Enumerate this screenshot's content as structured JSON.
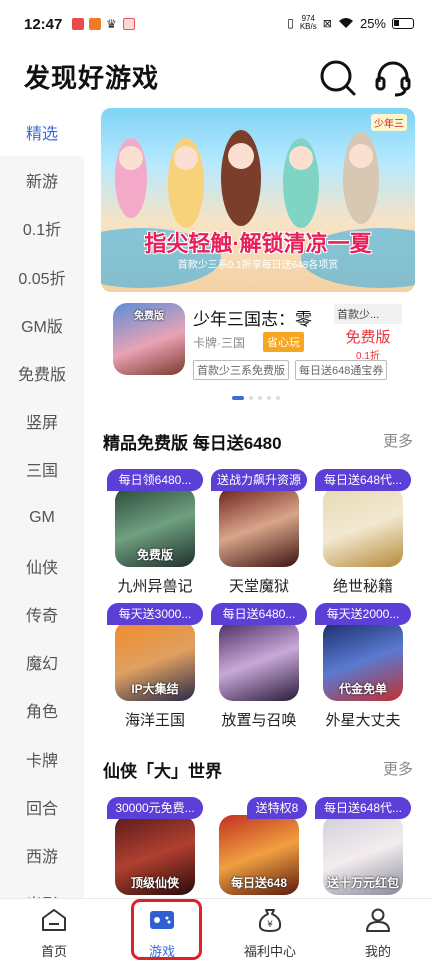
{
  "status_bar": {
    "time": "12:47",
    "net_speed_value": "974",
    "net_speed_unit": "KB/s",
    "battery": "25%"
  },
  "header": {
    "title": "发现好游戏",
    "icons": [
      "search-icon",
      "headset-icon"
    ]
  },
  "sidebar": {
    "items": [
      "精选",
      "新游",
      "0.1折",
      "0.05折",
      "GM版",
      "免费版",
      "竖屏",
      "三国",
      "GM",
      "仙侠",
      "传奇",
      "魔幻",
      "角色",
      "卡牌",
      "回合",
      "西游",
      "光影"
    ],
    "active_index": 0
  },
  "banner": {
    "logo_text": "少年三",
    "headline": "指尖轻触·解锁清凉一夏",
    "subline": "首款少三系0.1折享每日送648各项赏"
  },
  "featured": {
    "icon_label": "免费版",
    "title": "少年三国志：零",
    "subtitle": "卡牌·三国",
    "chip": "省心玩",
    "tags": [
      "首款少三系免费版",
      "每日送648通宝券"
    ],
    "promo_top": "首款少...",
    "promo_main": "免费版",
    "promo_sub": "0.1折"
  },
  "carousel": {
    "count": 5,
    "active_index": 0
  },
  "sections": [
    {
      "title": "精品免费版 每日送6480",
      "more": "更多",
      "games": [
        {
          "badge": "每日领6480...",
          "name": "九州异兽记",
          "icon_label": "免费版"
        },
        {
          "badge": "送战力飙升资源",
          "name": "天堂魔狱",
          "icon_label": ""
        },
        {
          "badge": "每日送648代...",
          "name": "绝世秘籍",
          "icon_label": ""
        },
        {
          "badge": "每天送3000...",
          "name": "海洋王国",
          "icon_label": "IP大集结"
        },
        {
          "badge": "每日送6480...",
          "name": "放置与召唤",
          "icon_label": ""
        },
        {
          "badge": "每天送2000...",
          "name": "外星大丈夫",
          "icon_label": "代金免单"
        }
      ]
    },
    {
      "title": "仙侠「大」世界",
      "more": "更多",
      "games": [
        {
          "badge": "30000元免费...",
          "name": "",
          "icon_label": "顶级仙侠"
        },
        {
          "badge": "送特权8",
          "name": "",
          "icon_label": "每日送648"
        },
        {
          "badge": "每日送648代...",
          "name": "",
          "icon_label": "送十万元红包"
        }
      ]
    }
  ],
  "bottom_nav": {
    "items": [
      {
        "label": "首页",
        "icon": "home-icon"
      },
      {
        "label": "游戏",
        "icon": "gamepad-icon"
      },
      {
        "label": "福利中心",
        "icon": "money-bag-icon"
      },
      {
        "label": "我的",
        "icon": "person-icon"
      }
    ],
    "active_index": 1
  },
  "colors": {
    "accent": "#3a6bd8",
    "badge_purple": "#5b3fd6",
    "promo_red": "#e8323b",
    "highlight_red": "#e21f26"
  }
}
